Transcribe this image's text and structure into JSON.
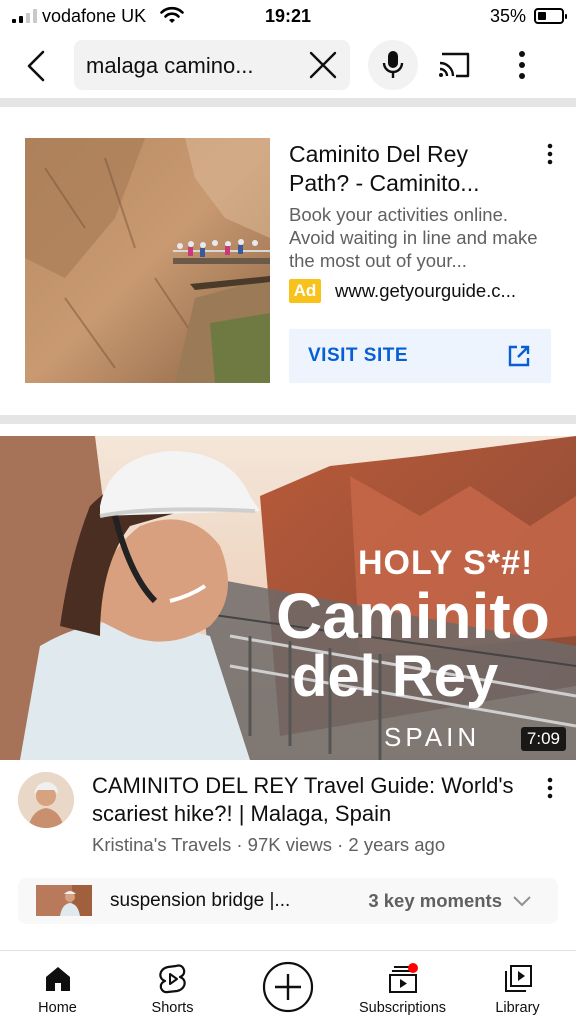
{
  "status_bar": {
    "carrier": "vodafone UK",
    "time": "19:21",
    "battery_percent": "35%",
    "battery_level": 0.35,
    "signal_bars": 2
  },
  "search": {
    "query": "malaga camino..."
  },
  "ad": {
    "title": "Caminito Del Rey Path? - Caminito...",
    "description": "Book your activities online. Avoid waiting in line and make the most out of your...",
    "badge": "Ad",
    "url": "www.getyourguide.c...",
    "visit_label": "VISIT SITE"
  },
  "video": {
    "overlay_line1": "HOLY S*#!",
    "overlay_line2": "Caminito",
    "overlay_line3": "del Rey",
    "overlay_line4": "SPAIN",
    "duration": "7:09",
    "title": "CAMINITO DEL REY Travel Guide: World's scariest hike?! | Malaga, Spain",
    "meta": "Kristina's Travels · 97K views · 2 years ago"
  },
  "key_moments": {
    "text": "suspension bridge |...",
    "count_label": "3 key moments"
  },
  "nav": {
    "items": [
      {
        "label": "Home",
        "icon": "home-icon"
      },
      {
        "label": "Shorts",
        "icon": "shorts-icon"
      },
      {
        "label": "",
        "icon": "create-icon"
      },
      {
        "label": "Subscriptions",
        "icon": "subscriptions-icon"
      },
      {
        "label": "Library",
        "icon": "library-icon"
      }
    ]
  },
  "colors": {
    "link_blue": "#065fd4",
    "ad_badge": "#f9c21b",
    "notification_red": "#ff0000",
    "secondary_text": "#606060"
  }
}
